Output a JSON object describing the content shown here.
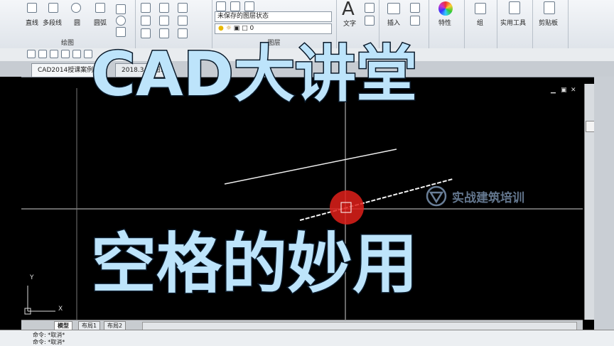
{
  "ribbon": {
    "draw_tools": [
      "直线",
      "多段线",
      "圆",
      "圆弧"
    ],
    "draw_panel_label": "绘图",
    "layer_state_value": "未保存的图层状态",
    "layer_value": "0",
    "layer_panel_label": "图层",
    "right_tools": [
      "文字",
      "插入",
      "特性",
      "组",
      "实用工具",
      "剪贴板"
    ]
  },
  "document_tabs": [
    "CAD2014授课案例",
    "2018.3.24图..."
  ],
  "layout_tabs": [
    "模型",
    "布局1",
    "布局2"
  ],
  "command_lines": [
    "命令: *取消*",
    "命令: *取消*"
  ],
  "overlay": {
    "title": "CAD大讲堂",
    "subtitle": "空格的妙用",
    "watermark": "实战建筑培训"
  },
  "ucs": {
    "x_label": "X",
    "y_label": "Y"
  },
  "colors": {
    "title_fill": "#bde4fb",
    "cursor_circle": "#e0201a",
    "canvas": "#000000"
  }
}
